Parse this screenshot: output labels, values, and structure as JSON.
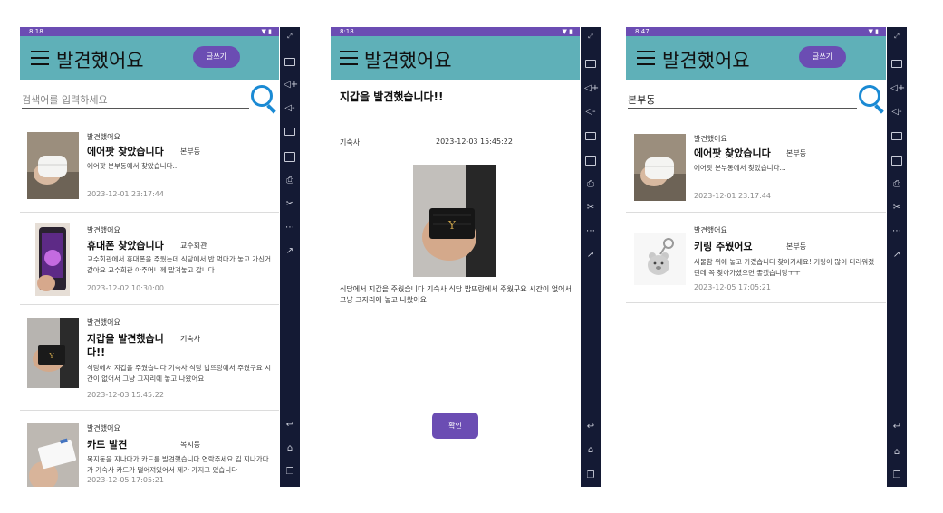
{
  "phones": [
    {
      "status_time": "8:18",
      "app_title": "발견했어요",
      "write_label": "글쓰기",
      "search_placeholder": "검색어를 입력하세요",
      "posts": [
        {
          "category": "발견했어요",
          "title": "에어팟 찾았습니다",
          "place": "본부동",
          "body": "에어팟 본부동에서 찾았습니다...",
          "date": "2023-12-01 23:17:44"
        },
        {
          "category": "발견했어요",
          "title": "휴대폰 찾았습니다",
          "place": "교수회관",
          "body": "교수회관에서 휴대폰을 주웠는데 식당에서 밥 먹다가 놓고 가신거 같아요 교수회관 아주머니께 맡겨놓고 갑니다",
          "date": "2023-12-02 10:30:00"
        },
        {
          "category": "발견했어요",
          "title": "지갑을 발견했습니다!!",
          "place": "기숙사",
          "body": "식당에서 지갑을 주웠습니다 기숙사 식당 밥뜨랑에서 주웠구요 시간이 없어서 그냥 그자리에 놓고 나왔어요",
          "date": "2023-12-03 15:45:22"
        },
        {
          "category": "발견했어요",
          "title": "카드 발견",
          "place": "복지동",
          "body": "복지동을 지나다가 카드를 발견했습니다 연락주세요 김 지나가다가 기숙사 카드가 떨어져있어서 제가 가지고 있습니다",
          "date": "2023-12-05 17:05:21"
        }
      ]
    },
    {
      "status_time": "8:18",
      "app_title": "발견했어요",
      "detail": {
        "title": "지갑을 발견했습니다!!",
        "place": "기숙사",
        "date": "2023-12-03 15:45:22",
        "body": "식당에서 지갑을 주웠습니다 기숙사 식당 밥뜨랑에서 주웠구요 시간이 없어서 그냥 그자리에 놓고 나왔어요",
        "confirm_label": "확인"
      }
    },
    {
      "status_time": "8:47",
      "app_title": "발견했어요",
      "write_label": "글쓰기",
      "search_value": "본부동",
      "posts": [
        {
          "category": "발견했어요",
          "title": "에어팟 찾았습니다",
          "place": "본부동",
          "body": "에어팟 본부동에서 찾았습니다...",
          "date": "2023-12-01 23:17:44"
        },
        {
          "category": "발견했어요",
          "title": "키링 주웠어요",
          "place": "본부동",
          "body": "사물함 위에 놓고 가겠습니다 찾아가세요! 키링이 많이 더러워졌던데 꼭 찾아가셨으면 좋겠습니당ㅜㅜ",
          "date": "2023-12-05 17:05:21"
        }
      ]
    }
  ],
  "icons": {
    "wifi": "wifi-icon",
    "battery": "battery-icon",
    "expand": "expand-icon",
    "keyboard": "keyboard-icon",
    "volume_up": "volume-up-icon",
    "volume_down": "volume-down-icon",
    "screen": "screen-icon",
    "rotate": "rotate-icon",
    "erase": "erase-icon",
    "scissors": "scissors-icon",
    "more": "more-icon",
    "share": "share-icon",
    "back": "back-icon",
    "home": "home-icon",
    "recents": "recents-icon"
  },
  "colors": {
    "appbar": "#5fb0b8",
    "accent": "#6b4db3",
    "statusbar": "#6b4db3",
    "navbar": "#141a34",
    "search": "#1a8ad4"
  }
}
